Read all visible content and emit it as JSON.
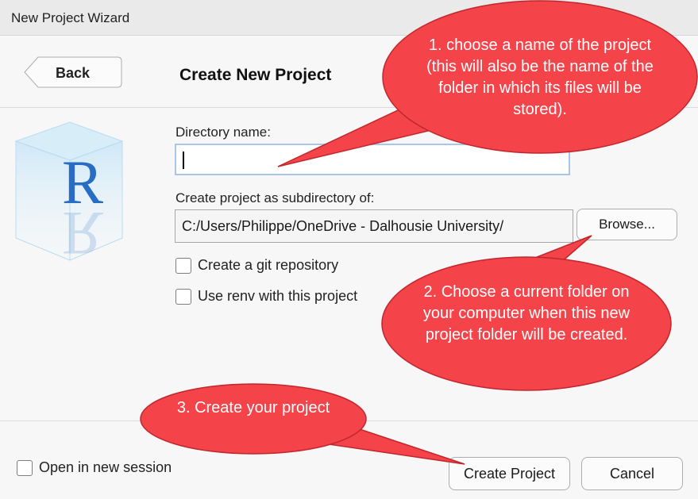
{
  "window": {
    "title": "New Project Wizard"
  },
  "header": {
    "back_label": "Back",
    "page_title": "Create New Project"
  },
  "form": {
    "directory_label": "Directory name:",
    "directory_value": "",
    "subdir_label": "Create project as subdirectory of:",
    "subdir_value": "C:/Users/Philippe/OneDrive - Dalhousie University/",
    "browse_label": "Browse...",
    "git_label": "Create a git repository",
    "git_checked": false,
    "renv_label": "Use renv with this project",
    "renv_checked": false
  },
  "footer": {
    "open_new_session_label": "Open in new session",
    "open_new_session_checked": false,
    "create_label": "Create Project",
    "cancel_label": "Cancel"
  },
  "callouts": [
    {
      "text": "1. choose a name of the project (this will also be the name of the folder in which its files will be stored)."
    },
    {
      "text": "2. Choose a current folder on your computer when this new project folder will be created."
    },
    {
      "text": "3. Create your project"
    }
  ],
  "colors": {
    "callout_fill": "#f4444a",
    "callout_stroke": "#c0272d",
    "input_focus_border": "#a9c6ea",
    "logo_blue": "#276dc3"
  },
  "icons": {
    "logo": "r-cube-logo"
  }
}
